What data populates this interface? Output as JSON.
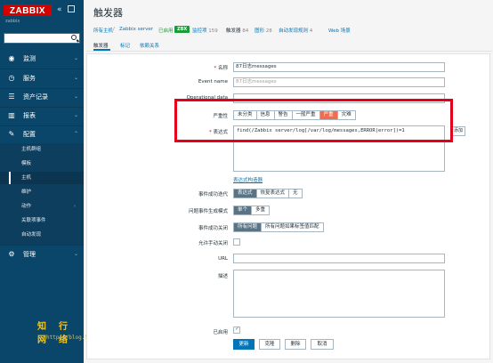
{
  "sidebar": {
    "logo": "ZABBIX",
    "server_label": "zabbix",
    "search": {
      "value": "",
      "placeholder": ""
    },
    "menu": [
      {
        "label": "监测",
        "icon": "eye-icon"
      },
      {
        "label": "服务",
        "icon": "clock-icon"
      },
      {
        "label": "资产记录",
        "icon": "list-icon"
      },
      {
        "label": "报表",
        "icon": "chart-icon"
      },
      {
        "label": "配置",
        "icon": "wrench-icon"
      }
    ],
    "submenu": [
      "主机群组",
      "模板",
      "主机",
      "维护",
      "动作",
      "关联项事件",
      "自动发现"
    ],
    "admin": {
      "label": "管理",
      "icon": "gear-icon"
    }
  },
  "watermark": {
    "text": "知行网络",
    "url": "http://blog.51cto.com/6300167",
    "mark": "|"
  },
  "page": {
    "title": "触发器"
  },
  "breadcrumb": {
    "all_hosts": "所有主机",
    "sep": "/",
    "host": "Zabbix server",
    "enabled": "已启用",
    "zbx": "ZBX",
    "items": {
      "label": "监控项",
      "count": "159"
    },
    "triggers": {
      "label": "触发器",
      "count": "84"
    },
    "graphs": {
      "label": "图形",
      "count": "28"
    },
    "discovery": {
      "label": "自动发现规则",
      "count": "4"
    },
    "web": "Web 场景"
  },
  "tabs": [
    "触发器",
    "标记",
    "依赖关系"
  ],
  "form": {
    "name": {
      "label": "名称",
      "value": "87日志messages"
    },
    "event_name": {
      "label": "Event name",
      "placeholder": "87日志messages"
    },
    "operational_data": {
      "label": "Operational data",
      "value": ""
    },
    "severity": {
      "label": "严重性",
      "options": [
        "未分类",
        "信息",
        "警告",
        "一般严重",
        "严重",
        "灾难"
      ],
      "selected": "严重"
    },
    "expression": {
      "label": "表达式",
      "value": "find(/Zabbix server/log[/var/log/messages,ERROR|error])=1",
      "add_label": "添加",
      "constructor_link": "表达式构造器"
    },
    "ok_event": {
      "label": "事件成功迭代",
      "options": [
        "表达式",
        "恢复表达式",
        "无"
      ],
      "selected": "表达式"
    },
    "problem_mode": {
      "label": "问题事件生成模式",
      "options": [
        "单个",
        "多重"
      ],
      "selected": "单个"
    },
    "ok_close": {
      "label": "事件成功关闭",
      "options": [
        "所有问题",
        "所有问题如果标签值匹配"
      ],
      "selected": "所有问题"
    },
    "manual_close": {
      "label": "允许手动关闭",
      "checked": false
    },
    "url": {
      "label": "URL",
      "value": ""
    },
    "description": {
      "label": "描述",
      "value": ""
    },
    "enabled": {
      "label": "已启用",
      "checked": true
    },
    "buttons": {
      "update": "更新",
      "clone": "克隆",
      "delete": "删除",
      "cancel": "取消"
    }
  },
  "colors": {
    "sidebar": "#0a466a",
    "accent": "#0275b8",
    "severity_high": "#f26c4f",
    "highlight_frame": "#e3001b",
    "logo": "#d40000"
  }
}
